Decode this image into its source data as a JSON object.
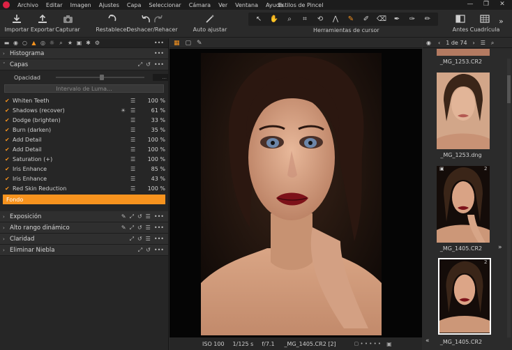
{
  "menubar": {
    "items": [
      "Archivo",
      "Editar",
      "Imagen",
      "Ajustes",
      "Capa",
      "Seleccionar",
      "Cámara",
      "Ver",
      "Ventana",
      "Ayuda"
    ],
    "window_title": "Estilos de Pincel",
    "controls": [
      "—",
      "❐",
      "✕"
    ]
  },
  "toolbar": {
    "import": "Importar",
    "export": "Exportar",
    "capture": "Capturar",
    "reset": "Restablecer",
    "undo_redo": "Deshacer/Rehacer",
    "auto_adjust": "Auto ajustar",
    "cursor_tools": "Herramientas de cursor",
    "before": "Antes",
    "grid": "Cuadrícula",
    "accent_color": "#f7931e"
  },
  "left_panel": {
    "histogram": "Histograma",
    "layers_title": "Capas",
    "opacity_label": "Opacidad",
    "opacity_value": "...",
    "luma_range": "Intervalo de Luma...",
    "layers": [
      {
        "name": "Whiten Teeth",
        "value": "100 %"
      },
      {
        "name": "Shadows (recover)",
        "value": "61 %"
      },
      {
        "name": "Dodge (brighten)",
        "value": "33 %"
      },
      {
        "name": "Burn (darken)",
        "value": "35 %"
      },
      {
        "name": "Add Detail",
        "value": "100 %"
      },
      {
        "name": "Add Detail",
        "value": "100 %"
      },
      {
        "name": "Saturation (+)",
        "value": "100 %"
      },
      {
        "name": "Iris Enhance",
        "value": "85 %"
      },
      {
        "name": "Iris Enhance",
        "value": "43 %"
      },
      {
        "name": "Red Skin Reduction",
        "value": "100 %"
      }
    ],
    "background_layer": "Fondo",
    "sections": [
      "Exposición",
      "Alto rango dinámico",
      "Claridad",
      "Eliminar Niebla"
    ]
  },
  "viewer": {
    "status": {
      "iso": "ISO 100",
      "shutter": "1/125 s",
      "aperture": "f/7.1",
      "filename": "_MG_1405.CR2 [2]"
    }
  },
  "browser": {
    "counter": "1 de 74",
    "thumbs": [
      {
        "name": "_MG_1253.CR2"
      },
      {
        "name": "_MG_1253.dng"
      },
      {
        "name": "_MG_1405.CR2",
        "badge": "2"
      },
      {
        "name": "_MG_1405.CR2",
        "badge": "2"
      }
    ]
  }
}
